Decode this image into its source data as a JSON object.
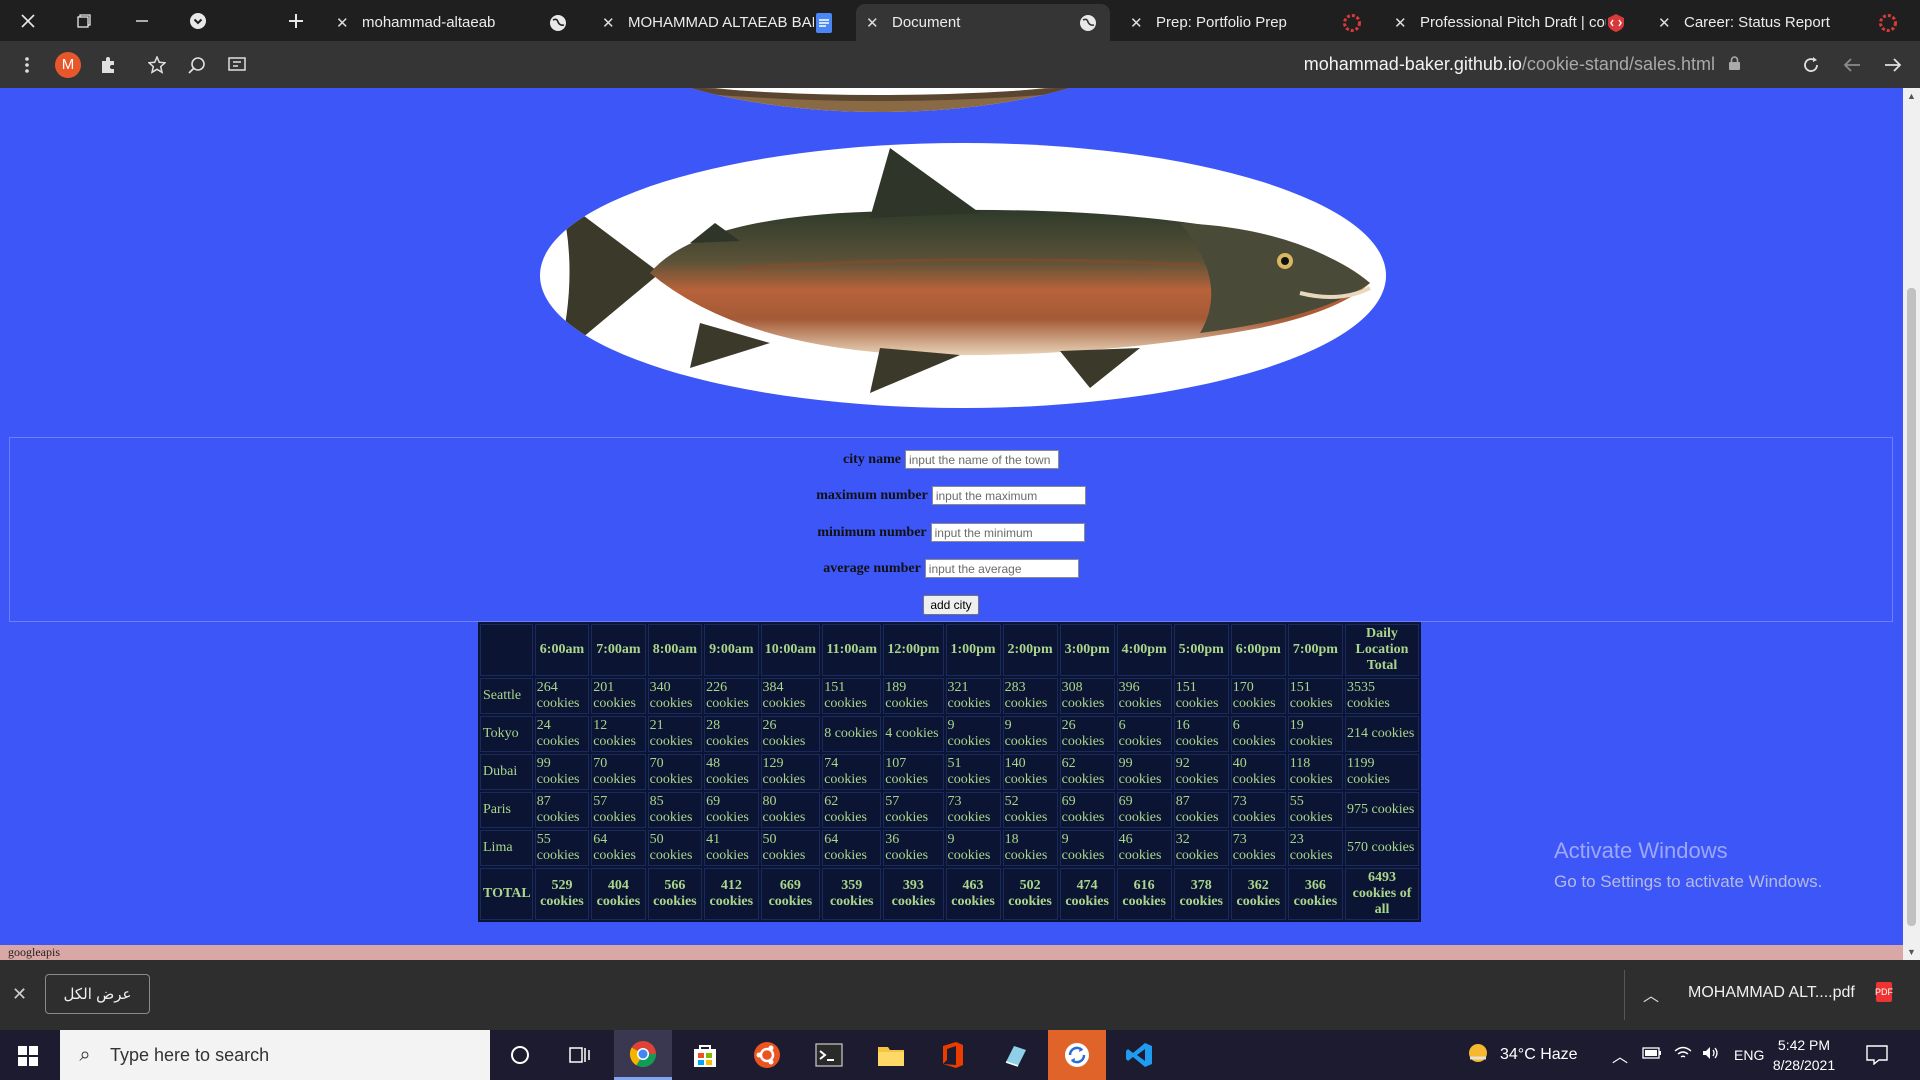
{
  "tabs": [
    {
      "title": "mohammad-altaeab",
      "active": false
    },
    {
      "title": "MOHAMMAD ALTAEAB BAKER",
      "active": false
    },
    {
      "title": "Document",
      "active": true
    },
    {
      "title": "Prep: Portfolio Prep",
      "active": false
    },
    {
      "title": "Professional Pitch Draft | course",
      "active": false
    },
    {
      "title": "Career: Status Report",
      "active": false
    }
  ],
  "toolbar": {
    "profile_initial": "M",
    "url_host": "mohammad-baker.github.io",
    "url_path": "/cookie-stand/sales.html"
  },
  "form": {
    "city_label": "city name",
    "city_placeholder": "input the name of the town",
    "max_label": "maximum number",
    "max_placeholder": "input the maximum",
    "min_label": "minimum number",
    "min_placeholder": "input the minimum",
    "avg_label": "average number",
    "avg_placeholder": "input the average",
    "submit_label": "add city"
  },
  "sales_table": {
    "corner": "",
    "headers": [
      "6:00am",
      "7:00am",
      "8:00am",
      "9:00am",
      "10:00am",
      "11:00am",
      "12:00pm",
      "1:00pm",
      "2:00pm",
      "3:00pm",
      "4:00pm",
      "5:00pm",
      "6:00pm",
      "7:00pm",
      "Daily Location Total"
    ],
    "rows": [
      {
        "city": "Seattle",
        "cells": [
          "264 cookies",
          "201 cookies",
          "340 cookies",
          "226 cookies",
          "384 cookies",
          "151 cookies",
          "189 cookies",
          "321 cookies",
          "283 cookies",
          "308 cookies",
          "396 cookies",
          "151 cookies",
          "170 cookies",
          "151 cookies",
          "3535 cookies"
        ]
      },
      {
        "city": "Tokyo",
        "cells": [
          "24 cookies",
          "12 cookies",
          "21 cookies",
          "28 cookies",
          "26 cookies",
          "8 cookies",
          "4 cookies",
          "9 cookies",
          "9 cookies",
          "26 cookies",
          "6 cookies",
          "16 cookies",
          "6 cookies",
          "19 cookies",
          "214 cookies"
        ]
      },
      {
        "city": "Dubai",
        "cells": [
          "99 cookies",
          "70 cookies",
          "70 cookies",
          "48 cookies",
          "129 cookies",
          "74 cookies",
          "107 cookies",
          "51 cookies",
          "140 cookies",
          "62 cookies",
          "99 cookies",
          "92 cookies",
          "40 cookies",
          "118 cookies",
          "1199 cookies"
        ]
      },
      {
        "city": "Paris",
        "cells": [
          "87 cookies",
          "57 cookies",
          "85 cookies",
          "69 cookies",
          "80 cookies",
          "62 cookies",
          "57 cookies",
          "73 cookies",
          "52 cookies",
          "69 cookies",
          "69 cookies",
          "87 cookies",
          "73 cookies",
          "55 cookies",
          "975 cookies"
        ]
      },
      {
        "city": "Lima",
        "cells": [
          "55 cookies",
          "64 cookies",
          "50 cookies",
          "41 cookies",
          "50 cookies",
          "64 cookies",
          "36 cookies",
          "9 cookies",
          "18 cookies",
          "9 cookies",
          "46 cookies",
          "32 cookies",
          "73 cookies",
          "23 cookies",
          "570 cookies"
        ]
      }
    ],
    "total_label": "TOTAL",
    "totals": [
      "529 cookies",
      "404 cookies",
      "566 cookies",
      "412 cookies",
      "669 cookies",
      "359 cookies",
      "393 cookies",
      "463 cookies",
      "502 cookies",
      "474 cookies",
      "616 cookies",
      "378 cookies",
      "362 cookies",
      "366 cookies",
      "6493 cookies of all"
    ]
  },
  "footer_text": "googleapis",
  "watermark": {
    "line1": "Activate Windows",
    "line2": "Go to Settings to activate Windows."
  },
  "download_bar": {
    "show_all": "عرض الكل",
    "file_name": "MOHAMMAD ALT....pdf"
  },
  "taskbar": {
    "search_placeholder": "Type here to search",
    "weather": "34°C  Haze",
    "language": "ENG",
    "time": "5:42 PM",
    "date": "8/28/2021"
  },
  "colors": {
    "page_bg": "#3d56f7",
    "table_bg": "#0b1433",
    "table_text": "#aad68b",
    "footer_bg": "#d9a7a6"
  },
  "icons": [
    "close-icon",
    "restore-icon",
    "minimize-icon",
    "tab-search-icon",
    "new-tab-icon",
    "globe-icon",
    "docs-icon",
    "menu-icon",
    "extensions-icon",
    "star-icon",
    "lens-icon",
    "cast-icon",
    "lock-icon",
    "reload-icon",
    "back-icon",
    "forward-icon",
    "windows-icon",
    "cortana-icon",
    "task-view-icon",
    "chrome-icon",
    "store-icon",
    "ubuntu-icon",
    "terminal-icon",
    "file-explorer-icon",
    "office-icon",
    "app-icon",
    "sync-icon",
    "vscode-icon",
    "notification-icon"
  ]
}
